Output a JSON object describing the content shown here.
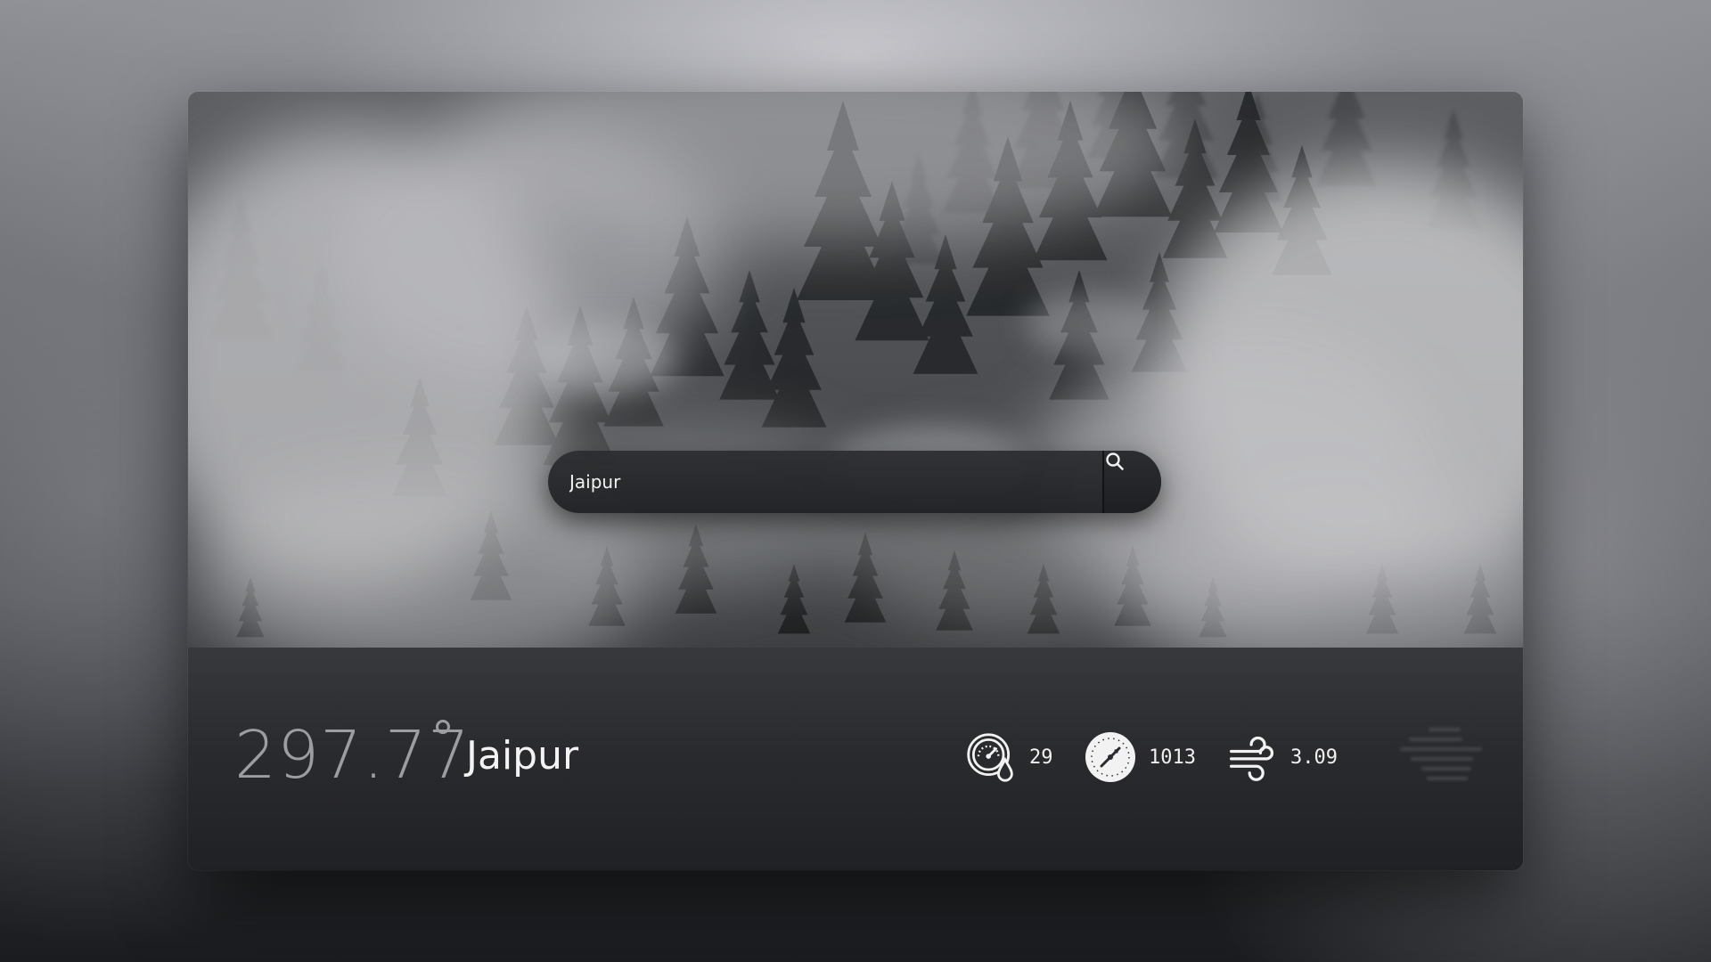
{
  "search": {
    "value": "Jaipur",
    "button_icon": "search-icon"
  },
  "weather": {
    "temperature": "297.77",
    "city": "Jaipur",
    "humidity": {
      "icon": "humidity-gauge-icon",
      "value": "29"
    },
    "pressure": {
      "icon": "pressure-compass-icon",
      "value": "1013"
    },
    "wind": {
      "icon": "wind-icon",
      "value": "3.09"
    },
    "condition_icon": "fog-icon"
  },
  "colors": {
    "panel": "#2a2b2e",
    "temperature_text": "#9c9da1",
    "text": "#f3f3f3"
  }
}
